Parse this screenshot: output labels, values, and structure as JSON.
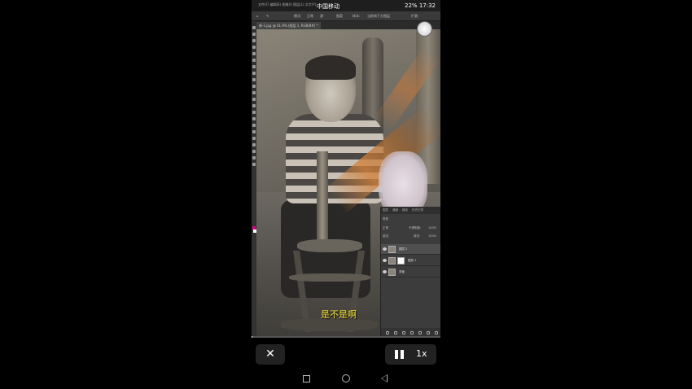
{
  "status_bar": {
    "menu_text": "文件(F)  编辑(E)  图像(I)  图层(L)  文字(Y)",
    "carrier": "中国移动",
    "battery": "22%",
    "time": "17:32"
  },
  "options_bar": {
    "mode_label": "模式:",
    "mode_value": "正常",
    "source_label": "源",
    "pattern_label": "图案",
    "sample_label": "样本:",
    "sample_value": "当前和下方图层",
    "diffusion_label": "扩散:"
  },
  "document": {
    "tab_label": "新-1.jpg @ 41.9% (图层 1, RGB/8#) *"
  },
  "layers_panel": {
    "tabs": [
      "图层",
      "通道",
      "路径",
      "历史记录"
    ],
    "filter_label": "类型",
    "blend_mode": "正常",
    "opacity_label": "不透明度:",
    "opacity_value": "100%",
    "lock_label": "锁定:",
    "fill_label": "填充:",
    "fill_value": "100%",
    "layers": [
      {
        "name": "图层 2",
        "selected": true,
        "has_mask": false
      },
      {
        "name": "图层 1",
        "selected": false,
        "has_mask": true
      },
      {
        "name": "背景",
        "selected": false,
        "has_mask": false
      }
    ]
  },
  "subtitle": "是不是啊",
  "player": {
    "close_label": "✕",
    "speed_label": "1x",
    "progress": 0.004
  },
  "colors": {
    "foreground": "#e0008a",
    "background": "#ffffff",
    "subtitle": "#f5e23a"
  },
  "icons": [
    "close-icon",
    "pause-icon",
    "home-square-icon",
    "home-circle-icon",
    "back-triangle-icon",
    "eye-icon",
    "brush-cursor-icon"
  ]
}
